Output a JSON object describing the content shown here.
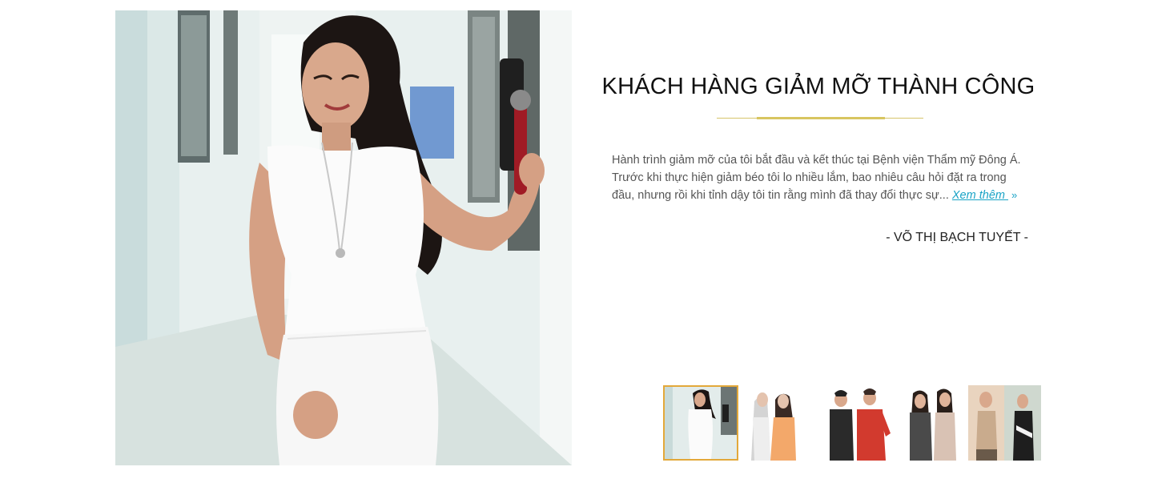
{
  "section": {
    "title": "KHÁCH HÀNG GIẢM MỠ THÀNH CÔNG"
  },
  "testimonial": {
    "text": "Hành trình giảm mỡ của tôi bắt đầu và kết thúc tại Bệnh viện Thẩm mỹ Đông Á. Trước khi thực hiện giảm béo tôi lo nhiều lắm, bao nhiêu câu hỏi đặt ra trong đầu, nhưng rồi khi tỉnh dậy tôi tin rằng mình đã thay đổi thực sự... ",
    "read_more": "Xem thêm ",
    "read_more_icon": "»",
    "author": "- VÕ THỊ BẠCH TUYẾT -"
  },
  "thumbnails": {
    "active_index": 0,
    "count": 5
  },
  "colors": {
    "accent_gold": "#d8c560",
    "link": "#1aa3c6",
    "active_thumb_border": "#e3a83a"
  }
}
